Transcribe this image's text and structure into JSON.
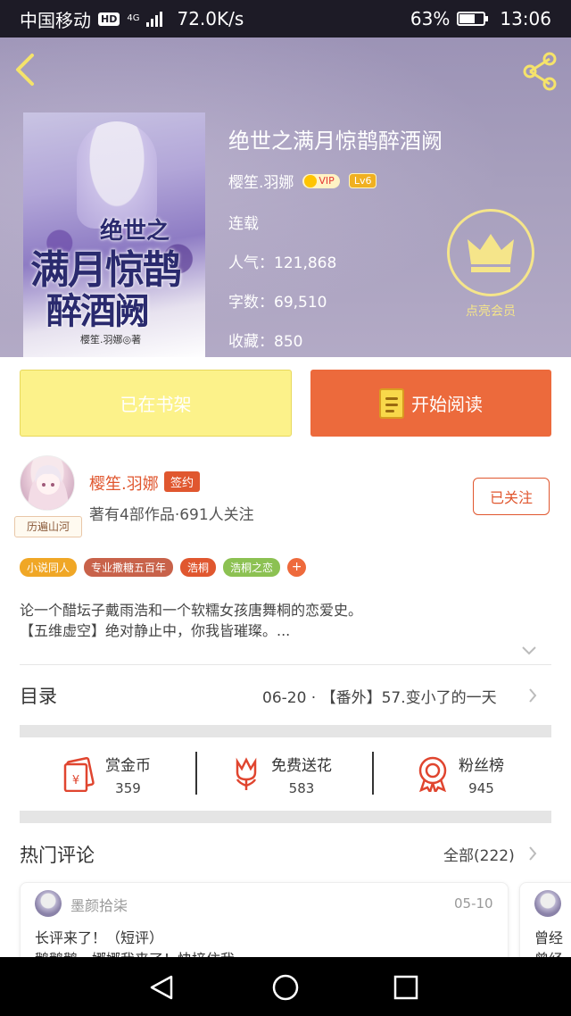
{
  "status_bar": {
    "carrier": "中国移动",
    "hd": "HD",
    "network": "4G",
    "speed": "72.0K/s",
    "battery_level": 0.63,
    "battery": "63%",
    "time": "13:06"
  },
  "header": {
    "back_icon": "chevron-left-icon",
    "share_icon": "share-icon"
  },
  "book": {
    "cover_title_1": "绝世之",
    "cover_title_2": "满月惊鹊",
    "cover_title_3": "醉酒阙",
    "cover_author": "樱笙.羽娜◎著",
    "title": "绝世之满月惊鹊醉酒阙",
    "author": "樱笙.羽娜",
    "vip": "VIP",
    "level": "Lv6",
    "status": "连载",
    "popularity": "人气：121,868",
    "word_count": "字数：69,510",
    "favorites": "收藏：850",
    "vip_member_label": "点亮会员"
  },
  "actions": {
    "shelf": "已在书架",
    "read": "开始阅读"
  },
  "author_card": {
    "name": "樱笙.羽娜",
    "sign_badge": "签约",
    "meta": "著有4部作品·691人关注",
    "avatar_tag": "历遍山河",
    "follow": "已关注"
  },
  "tags": [
    {
      "label": "小说同人",
      "color": "#f0a726"
    },
    {
      "label": "专业撒糖五百年",
      "color": "#c8624a"
    },
    {
      "label": "浩桐",
      "color": "#e0572f"
    },
    {
      "label": "浩桐之恋",
      "color": "#8cc152"
    }
  ],
  "tag_add": "+",
  "description": {
    "line1": "论一个醋坛子戴雨浩和一个软糯女孩唐舞桐的恋爱史。",
    "line2": "【五维虚空】绝对静止中，你我皆璀璨。..."
  },
  "toc": {
    "label": "目录",
    "latest": "06-20 · 【番外】57.变小了的一天"
  },
  "stats": [
    {
      "label": "赏金币",
      "value": "359",
      "icon": "red-envelope-icon"
    },
    {
      "label": "免费送花",
      "value": "583",
      "icon": "flower-icon"
    },
    {
      "label": "粉丝榜",
      "value": "945",
      "icon": "medal-icon"
    }
  ],
  "hot_comments": {
    "title": "热门评论",
    "all": "全部(222)",
    "items": [
      {
        "user": "墨颜拾柒",
        "date": "05-10",
        "line1": "长评来了！（短评）",
        "line2": "鹅鹅鹅，娜娜我来了！快接住我"
      },
      {
        "user": "",
        "date": "",
        "line1": "曾经",
        "line2": "曾经"
      }
    ]
  },
  "nav": {
    "back": "triangle-back-icon",
    "home": "circle-home-icon",
    "recent": "square-recent-icon"
  },
  "colors": {
    "accent": "#ec6a3c",
    "shelf": "#fcf28a",
    "author": "#e0572f"
  }
}
